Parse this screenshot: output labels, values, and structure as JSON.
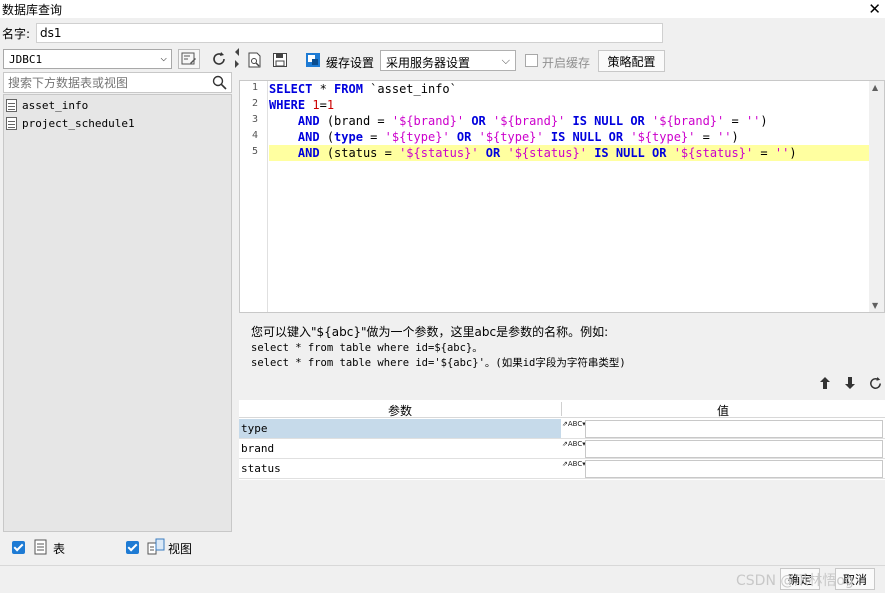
{
  "window": {
    "title": "数据库查询",
    "close_icon": "close-icon"
  },
  "name_field": {
    "label": "名字:",
    "value": "ds1"
  },
  "left": {
    "connection": "JDBC1",
    "search_placeholder": "搜索下方数据表或视图",
    "tables": [
      "asset_info",
      "project_schedule1"
    ],
    "show_tables_label": "表",
    "show_views_label": "视图",
    "show_tables_checked": true,
    "show_views_checked": true
  },
  "toolbar": {
    "cache_label": "缓存设置",
    "cache_option": "采用服务器设置",
    "enable_cache_label": "开启缓存",
    "enable_cache_checked": false,
    "strategy_button": "策略配置"
  },
  "editor": {
    "line_numbers": [
      "1",
      "2",
      "3",
      "4",
      "5"
    ],
    "highlight_line": 5
  },
  "hint": {
    "line1": "您可以键入\"${abc}\"做为一个参数，这里abc是参数的名称。例如:",
    "line2": "select * from table where id=${abc}。",
    "line3": "select * from table where id='${abc}'。(如果id字段为字符串类型)"
  },
  "params": {
    "header_param": "参数",
    "header_value": "值",
    "type_icon_text": "ABC",
    "rows": [
      {
        "name": "type",
        "value": "",
        "selected": true
      },
      {
        "name": "brand",
        "value": "",
        "selected": false
      },
      {
        "name": "status",
        "value": "",
        "selected": false
      }
    ]
  },
  "footer": {
    "ok_button": "确定",
    "cancel_button": "取消",
    "watermark": "CSDN @爪林悟og"
  },
  "colors": {
    "accent": "#1e7bd4",
    "keyword": "#0000dd",
    "string": "#cc00cc",
    "number": "#cc0000",
    "highlight_line": "#ffffa0",
    "selected_row": "#c6daea"
  }
}
